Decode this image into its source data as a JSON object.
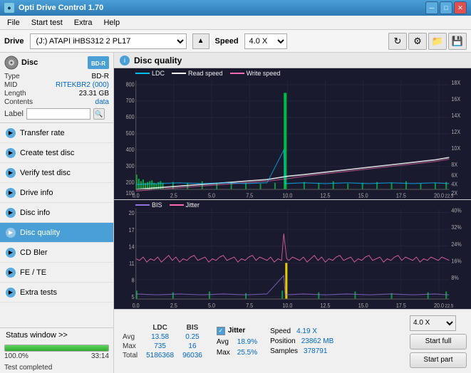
{
  "app": {
    "title": "Opti Drive Control 1.70",
    "icon": "●"
  },
  "titlebar": {
    "minimize": "─",
    "maximize": "□",
    "close": "✕"
  },
  "menubar": {
    "items": [
      "File",
      "Start test",
      "Extra",
      "Help"
    ]
  },
  "drivebar": {
    "label": "Drive",
    "drive_value": "(J:) ATAPI iHBS312  2 PL17",
    "speed_label": "Speed",
    "speed_value": "4.0 X"
  },
  "disc": {
    "title": "Disc",
    "type_label": "Type",
    "type_val": "BD-R",
    "mid_label": "MID",
    "mid_val": "RITEKBR2 (000)",
    "length_label": "Length",
    "length_val": "23.31 GB",
    "contents_label": "Contents",
    "contents_val": "data",
    "label_label": "Label",
    "label_placeholder": ""
  },
  "sidebar": {
    "items": [
      {
        "id": "transfer-rate",
        "label": "Transfer rate",
        "active": false
      },
      {
        "id": "create-test-disc",
        "label": "Create test disc",
        "active": false
      },
      {
        "id": "verify-test-disc",
        "label": "Verify test disc",
        "active": false
      },
      {
        "id": "drive-info",
        "label": "Drive info",
        "active": false
      },
      {
        "id": "disc-info",
        "label": "Disc info",
        "active": false
      },
      {
        "id": "disc-quality",
        "label": "Disc quality",
        "active": true
      },
      {
        "id": "cd-bler",
        "label": "CD Bler",
        "active": false
      },
      {
        "id": "fe-te",
        "label": "FE / TE",
        "active": false
      },
      {
        "id": "extra-tests",
        "label": "Extra tests",
        "active": false
      }
    ],
    "status_window": "Status window >>"
  },
  "disc_quality": {
    "title": "Disc quality",
    "legend": {
      "ldc": "LDC",
      "read_speed": "Read speed",
      "write_speed": "Write speed"
    },
    "legend2": {
      "bis": "BIS",
      "jitter": "Jitter"
    },
    "chart1_ymax": 800,
    "chart1_yright": 18,
    "chart2_ymax": 20,
    "chart2_yright": 40
  },
  "stats": {
    "headers": [
      "LDC",
      "BIS"
    ],
    "avg_label": "Avg",
    "avg_ldc": "13.58",
    "avg_bis": "0.25",
    "max_label": "Max",
    "max_ldc": "735",
    "max_bis": "16",
    "total_label": "Total",
    "total_ldc": "5186368",
    "total_bis": "96036",
    "jitter_label": "Jitter",
    "jitter_avg": "18.9%",
    "jitter_max": "25.5%",
    "speed_label": "Speed",
    "speed_val": "4.19 X",
    "position_label": "Position",
    "position_val": "23862 MB",
    "samples_label": "Samples",
    "samples_val": "378791",
    "speed_select": "4.0 X",
    "btn_start_full": "Start full",
    "btn_start_part": "Start part"
  },
  "statusbar": {
    "text": "Test completed",
    "progress": 100,
    "progress_text": "100.0%",
    "time": "33:14"
  },
  "colors": {
    "ldc": "#00bfff",
    "read_speed": "#ffffff",
    "write_speed": "#ff69b4",
    "bis": "#9370db",
    "jitter": "#ff69b4",
    "grid": "#2a2a4a",
    "bg": "#1a1a2e"
  }
}
